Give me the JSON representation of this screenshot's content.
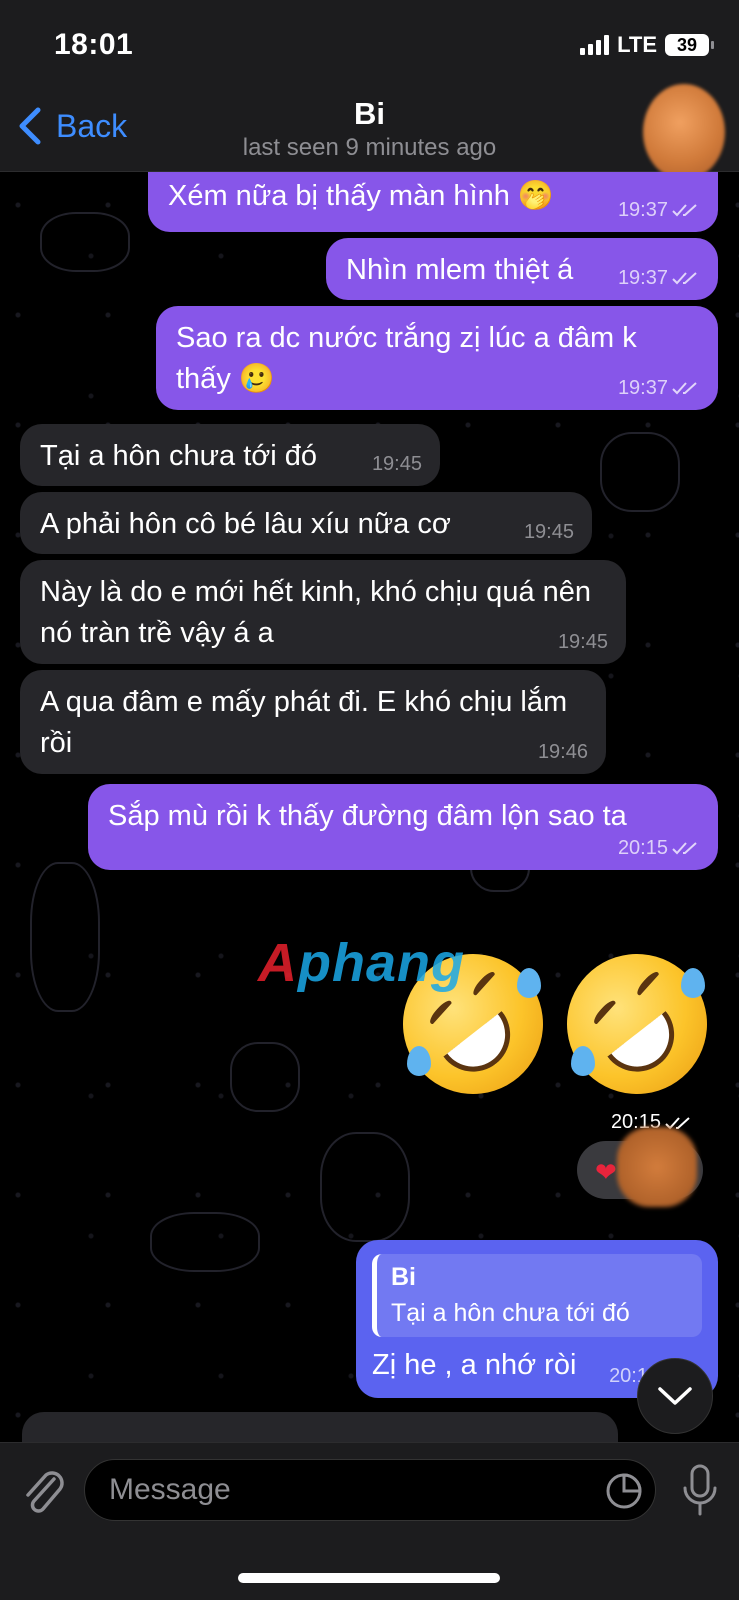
{
  "status_bar": {
    "time": "18:01",
    "network": "LTE",
    "battery": "39"
  },
  "header": {
    "back_label": "Back",
    "contact_name": "Bi",
    "last_seen": "last seen 9 minutes ago"
  },
  "messages": [
    {
      "dir": "out",
      "text": "Xém nữa bị thấy màn hình 🤭",
      "time": "19:37",
      "read": true
    },
    {
      "dir": "out",
      "text": "Nhìn mlem thiệt á",
      "time": "19:37",
      "read": true
    },
    {
      "dir": "out",
      "text": "Sao ra dc nước trắng zị lúc a đâm k thấy 🥲",
      "time": "19:37",
      "read": true
    },
    {
      "dir": "in",
      "text": "Tại a hôn chưa tới đó",
      "time": "19:45"
    },
    {
      "dir": "in",
      "text": "A phải hôn cô bé lâu xíu nữa cơ",
      "time": "19:45"
    },
    {
      "dir": "in",
      "text": "Này là do e mới hết kinh, khó chịu quá nên nó tràn trề vậy á a",
      "time": "19:45"
    },
    {
      "dir": "in",
      "text": "A qua đâm e mấy phát đi. E khó chịu lắm rồi",
      "time": "19:46"
    },
    {
      "dir": "out",
      "text": "Sắp mù rồi k thấy đường đâm lộn sao ta",
      "time": "20:15",
      "read": true
    }
  ],
  "emoji_message": {
    "emoji": "🤣🤣",
    "time": "20:15",
    "read": true
  },
  "reaction": {
    "icon": "heart"
  },
  "reply_message": {
    "reply_to_name": "Bi",
    "reply_to_text": "Tại a hôn chưa tới đó",
    "text": "Zị he , a nhớ ròi",
    "time": "20:1"
  },
  "watermark": {
    "part1": "A",
    "part2": "phang"
  },
  "composer": {
    "placeholder": "Message"
  },
  "colors": {
    "accent": "#3e8dff",
    "outgoing": "#8756e9",
    "incoming": "#26262a"
  }
}
